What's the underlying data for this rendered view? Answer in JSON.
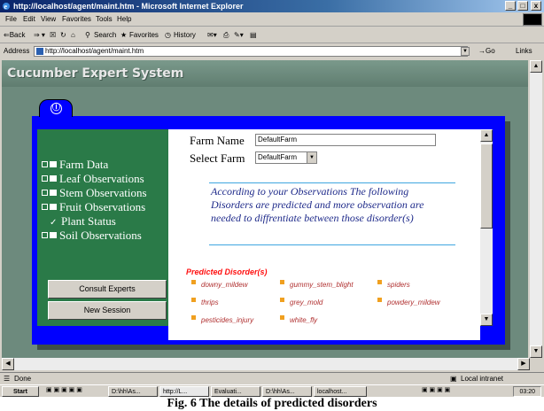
{
  "window": {
    "title": "http://localhost/agent/maint.htm - Microsoft Internet Explorer",
    "controls": [
      "_",
      "□",
      "x"
    ]
  },
  "menu": [
    "File",
    "Edit",
    "View",
    "Favorites",
    "Tools",
    "Help"
  ],
  "toolbar": {
    "back": "⇐Back",
    "search": "Search",
    "favorites": "Favorites",
    "history": "History"
  },
  "address": {
    "label": "Address",
    "url": "http://localhost/agent/maint.htm",
    "go": "Go",
    "links": "Links"
  },
  "app": {
    "title": "Cucumber Expert System",
    "info_icon": "Ⓘ"
  },
  "sidebar": {
    "items": [
      {
        "label": "Farm Data",
        "icon": "checkbox-folder"
      },
      {
        "label": "Leaf Observations",
        "icon": "checkbox-folder"
      },
      {
        "label": "Stem Observations",
        "icon": "checkbox-folder"
      },
      {
        "label": "Fruit Observations",
        "icon": "checkbox-folder"
      },
      {
        "label": "Plant Status",
        "icon": "check-icon"
      },
      {
        "label": "Soil Observations",
        "icon": "checkbox-folder"
      }
    ],
    "consult_button": "Consult Experts",
    "new_session_button": "New Session"
  },
  "form": {
    "farm_name_label": "Farm Name",
    "farm_name_value": "DefaultFarm",
    "select_farm_label": "Select Farm",
    "select_farm_value": "DefaultFarm"
  },
  "message": "According to your Observations The following Disorders are predicted and more observation are needed to diffrentiate between those disorder(s)",
  "predicted": {
    "title": "Predicted Disorder(s)",
    "items": [
      "downy_mildew",
      "gummy_stem_blight",
      "spiders",
      "thrips",
      "grey_mold",
      "powdery_mildew",
      "pesticides_injury",
      "white_fly"
    ]
  },
  "status": {
    "left": "Done",
    "right": "Local intranet"
  },
  "taskbar": {
    "start": "Start",
    "tasks": [
      "D:\\hh\\As...",
      "http://L...",
      "Evaluati...",
      "D:\\hh\\As...",
      "localhost..."
    ],
    "clock": "03:20"
  },
  "caption": "Fig. 6 The details of predicted disorders",
  "colors": {
    "frame_blue": "#0000ff",
    "sidebar_green": "#2a7a48",
    "page_bg": "#6d8a7d",
    "disorder_red": "#b03030"
  }
}
